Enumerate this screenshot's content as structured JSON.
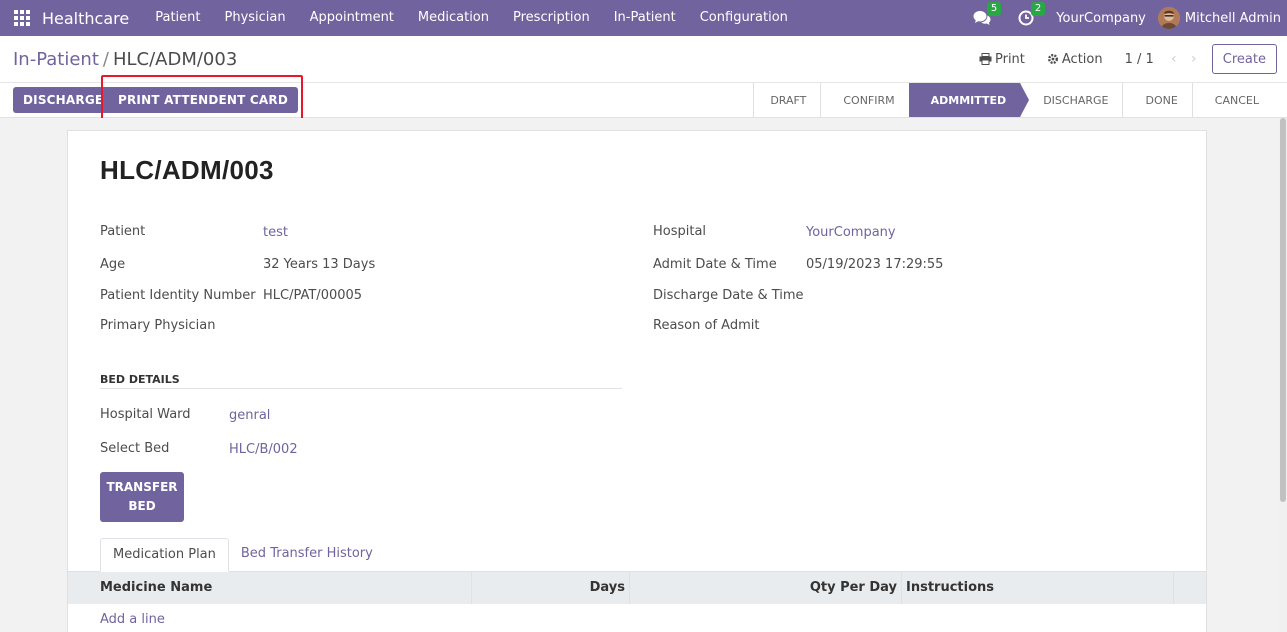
{
  "navbar": {
    "brand": "Healthcare",
    "menu": [
      "Patient",
      "Physician",
      "Appointment",
      "Medication",
      "Prescription",
      "In-Patient",
      "Configuration"
    ],
    "messages_count": "5",
    "activities_count": "2",
    "company": "YourCompany",
    "user": "Mitchell Admin"
  },
  "control_panel": {
    "breadcrumb_parent": "In-Patient",
    "breadcrumb_current": "HLC/ADM/003",
    "print_label": "Print",
    "action_label": "Action",
    "pager": "1 / 1",
    "create_label": "Create"
  },
  "header_buttons": {
    "discharge": "DISCHARGE",
    "print_attendent_card": "PRINT ATTENDENT CARD"
  },
  "statusbar": {
    "stages": [
      "DRAFT",
      "CONFIRM",
      "ADMMITTED",
      "DISCHARGE",
      "DONE",
      "CANCEL"
    ],
    "active_index": 2
  },
  "form": {
    "title": "HLC/ADM/003",
    "left_fields": [
      {
        "label": "Patient",
        "value": "test"
      },
      {
        "label": "Age",
        "value": "32 Years 13 Days"
      },
      {
        "label": "Patient Identity Number",
        "value": "HLC/PAT/00005"
      },
      {
        "label": "Primary Physician",
        "value": ""
      }
    ],
    "right_fields": [
      {
        "label": "Hospital",
        "value": "YourCompany"
      },
      {
        "label": "Admit Date & Time",
        "value": "05/19/2023 17:29:55"
      },
      {
        "label": "Discharge Date & Time",
        "value": ""
      },
      {
        "label": "Reason of Admit",
        "value": ""
      }
    ],
    "bed_section_title": "BED DETAILS",
    "bed_fields": [
      {
        "label": "Hospital Ward",
        "value": "genral"
      },
      {
        "label": "Select Bed",
        "value": "HLC/B/002"
      }
    ],
    "transfer_bed_line1": "TRANSFER",
    "transfer_bed_line2": "BED",
    "tabs": [
      "Medication Plan",
      "Bed Transfer History"
    ],
    "table_columns": [
      "Medicine Name",
      "Days",
      "Qty Per Day",
      "Instructions"
    ],
    "add_line": "Add a line"
  },
  "colors": {
    "primary": "#71639e",
    "highlight": "#e8172b",
    "badge": "#28a745"
  }
}
